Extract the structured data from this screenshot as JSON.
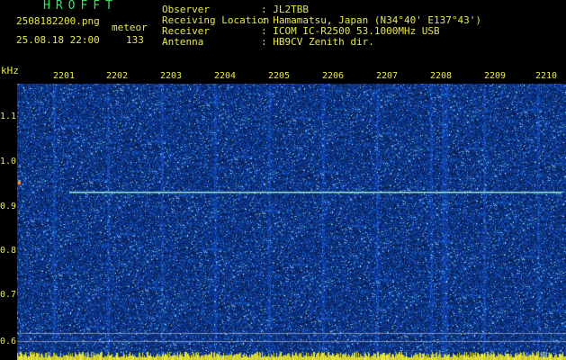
{
  "header": {
    "app_title": "HROFFT",
    "filename": "2508182200.png",
    "datetime": "25.08.18 22:00",
    "meteor_label": "meteor",
    "meteor_count": "133"
  },
  "info": {
    "observer": {
      "label": "Observer",
      "value": ": JL2TBB"
    },
    "location": {
      "label": "Receiving Location",
      "value": ": Hamamatsu, Japan (N34°40' E137°43')"
    },
    "receiver": {
      "label": "Receiver",
      "value": ": ICOM IC-R2500 53.1000MHz USB"
    },
    "antenna": {
      "label": "Antenna",
      "value": ": HB9CV Zenith dir."
    }
  },
  "axis": {
    "y_unit": "kHz",
    "y_ticks": [
      "1.1",
      "1.0",
      "0.9",
      "0.8",
      "0.7",
      "0.6"
    ],
    "x_ticks": [
      "2201",
      "2202",
      "2203",
      "2204",
      "2205",
      "2206",
      "2207",
      "2208",
      "2209",
      "2210"
    ]
  },
  "colors": {
    "background": "#000000",
    "text_yellow": "#e8e84a",
    "title_green": "#30e85a",
    "noise_base": "#0d2a9e",
    "signal_line": "#a8f0d8"
  }
}
